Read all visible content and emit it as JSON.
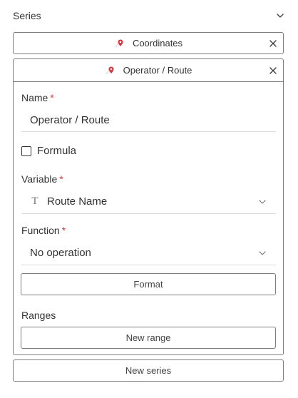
{
  "section": {
    "title": "Series"
  },
  "series_items": [
    {
      "label": "Coordinates"
    },
    {
      "label": "Operator / Route"
    }
  ],
  "form": {
    "name_label": "Name",
    "name_value": "Operator / Route",
    "required_mark": "*",
    "formula_label": "Formula",
    "formula_checked": false,
    "variable_label": "Variable",
    "variable_value": "Route Name",
    "variable_type_icon": "T",
    "function_label": "Function",
    "function_value": "No operation",
    "format_button": "Format",
    "ranges_label": "Ranges",
    "new_range_button": "New range"
  },
  "new_series_button": "New series",
  "colors": {
    "pin_red": "#d9363e",
    "border": "#7d7d7d",
    "required": "#d9363e"
  },
  "icons": {
    "collapse": "chevron-down-icon",
    "pin": "map-pin-icon",
    "remove": "close-icon",
    "text_type": "text-type-icon"
  }
}
